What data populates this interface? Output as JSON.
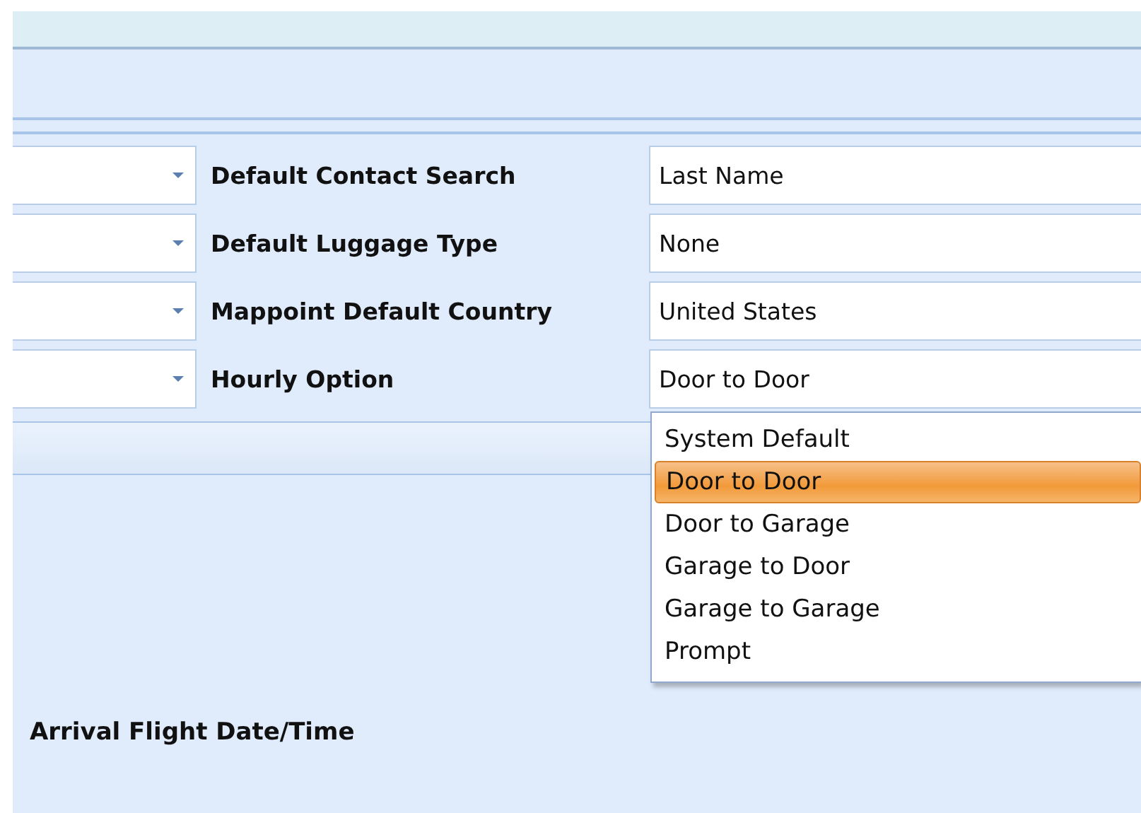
{
  "form_rows": [
    {
      "label": "Default Contact Search",
      "value": "Last Name"
    },
    {
      "label": "Default Luggage Type",
      "value": "None"
    },
    {
      "label": "Mappoint Default Country",
      "value": "United States"
    },
    {
      "label": "Hourly Option",
      "value": "Door to Door",
      "options": [
        {
          "label": "System Default",
          "selected": false
        },
        {
          "label": "Door to Door",
          "selected": true
        },
        {
          "label": "Door to Garage",
          "selected": false
        },
        {
          "label": "Garage to Door",
          "selected": false
        },
        {
          "label": "Garage to Garage",
          "selected": false
        },
        {
          "label": "Prompt",
          "selected": false
        }
      ]
    }
  ],
  "footer_label": "Arrival Flight Date/Time"
}
